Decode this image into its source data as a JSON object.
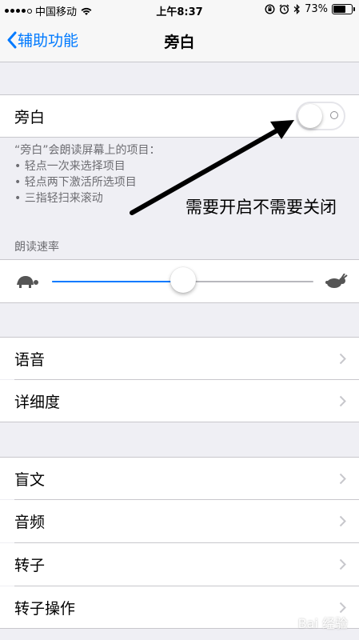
{
  "status_bar": {
    "carrier": "中国移动",
    "time": "上午8:37",
    "battery": "73%",
    "battery_level": 0.73,
    "icons": [
      "signal-dots-icon",
      "wifi-icon",
      "rotation-lock-icon",
      "alarm-icon",
      "bluetooth-icon",
      "battery-icon"
    ]
  },
  "nav": {
    "back_label": "辅助功能",
    "back_icon": "chevron-left-icon",
    "title": "旁白"
  },
  "voiceover": {
    "label": "旁白",
    "toggle_on": false,
    "footer_lines": [
      "“旁白”会朗读屏幕上的项目：",
      "• 轻点一次来选择项目",
      "• 轻点两下激活所选项目",
      "• 三指轻扫来滚动"
    ]
  },
  "speaking_rate": {
    "header": "朗读速率",
    "value": 0.5,
    "min_icon": "turtle-icon",
    "max_icon": "rabbit-icon"
  },
  "group1": [
    {
      "label": "语音"
    },
    {
      "label": "详细度"
    }
  ],
  "group2": [
    {
      "label": "盲文"
    },
    {
      "label": "音频"
    },
    {
      "label": "转子"
    },
    {
      "label": "转子操作"
    }
  ],
  "annotation": {
    "text": "需要开启不需要关闭"
  },
  "watermark": "Bai 经验",
  "colors": {
    "accent": "#007aff",
    "background": "#efeff4",
    "separator": "#c8c7cc",
    "secondary_text": "#6d6d72"
  }
}
